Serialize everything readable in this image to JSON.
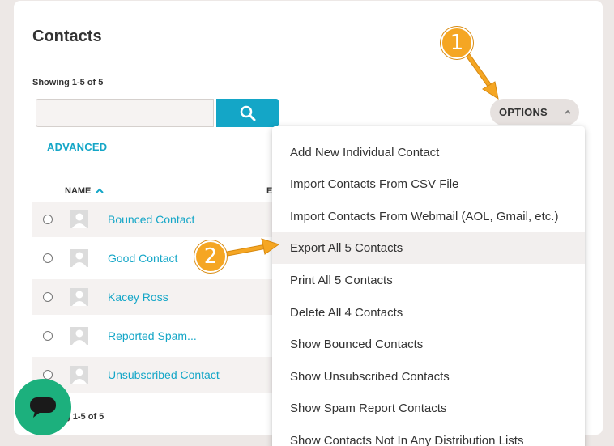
{
  "page": {
    "title": "Contacts",
    "showing": "Showing 1-5 of 5",
    "footer_showing": "g 1-5 of 5"
  },
  "search": {
    "placeholder": "",
    "button_icon": "search-icon"
  },
  "advanced_label": "ADVANCED",
  "options": {
    "label": "OPTIONS",
    "icon": "chevron-up-icon"
  },
  "table": {
    "name_header": "NAME",
    "partial_header": "E",
    "sort_icon": "sort-ascending-icon",
    "rows": [
      {
        "name": "Bounced Contact"
      },
      {
        "name": "Good Contact"
      },
      {
        "name": "Kacey Ross"
      },
      {
        "name": "Reported Spam..."
      },
      {
        "name": "Unsubscribed Contact"
      }
    ]
  },
  "menu": {
    "items": [
      {
        "label": "Add New Individual Contact"
      },
      {
        "label": "Import Contacts From CSV File"
      },
      {
        "label": "Import Contacts From Webmail (AOL, Gmail, etc.)"
      },
      {
        "label": "Export All 5 Contacts"
      },
      {
        "label": "Print All 5 Contacts"
      },
      {
        "label": "Delete All 4 Contacts"
      },
      {
        "label": "Show Bounced Contacts"
      },
      {
        "label": "Show Unsubscribed Contacts"
      },
      {
        "label": "Show Spam Report Contacts"
      },
      {
        "label": "Show Contacts Not In Any Distribution Lists"
      }
    ],
    "highlighted_index": 3
  },
  "callouts": [
    {
      "label": "1"
    },
    {
      "label": "2"
    }
  ],
  "colors": {
    "accent": "#14a6c7",
    "callout": "#f5a623",
    "chat": "#1cb07d",
    "background": "#ede8e6"
  }
}
